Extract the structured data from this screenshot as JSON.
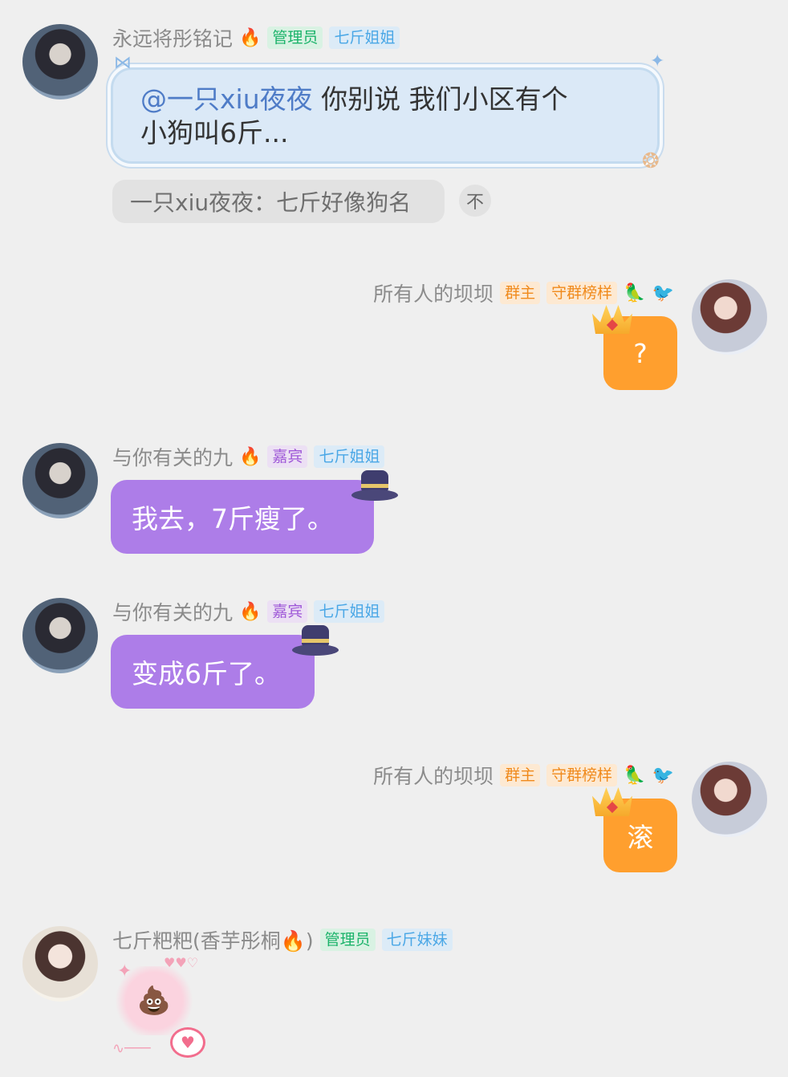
{
  "messages": [
    {
      "sender": "永远将彤铭记",
      "badges": [
        "管理员",
        "七斤姐姐"
      ],
      "mention": "@一只xiu夜夜",
      "text_line1": "你别说 我们小区有个",
      "text_line2": "小狗叫6斤...",
      "quote": "一只xiu夜夜：七斤好像狗名",
      "quote_button": "不"
    },
    {
      "sender": "所有人的坝坝",
      "badges": [
        "群主",
        "守群榜样"
      ],
      "text": "?"
    },
    {
      "sender": "与你有关的九",
      "badges": [
        "嘉宾",
        "七斤姐姐"
      ],
      "text": "我去，7斤瘦了。"
    },
    {
      "sender": "与你有关的九",
      "badges": [
        "嘉宾",
        "七斤姐姐"
      ],
      "text": "变成6斤了。"
    },
    {
      "sender": "所有人的坝坝",
      "badges": [
        "群主",
        "守群榜样"
      ],
      "text": "滚"
    },
    {
      "sender": "七斤粑粑(香芋彤桐🔥)",
      "badges": [
        "管理员",
        "七斤妹妹"
      ],
      "sticker": "💩"
    }
  ],
  "icons": {
    "fire": "🔥",
    "parrot": "🦜",
    "bird": "🐦",
    "heart": "♥"
  },
  "colors": {
    "background": "#efefef",
    "purple_bubble": "#ad7de8",
    "orange_bubble": "#ff9f2e",
    "card_bubble": "#dbe9f7"
  }
}
